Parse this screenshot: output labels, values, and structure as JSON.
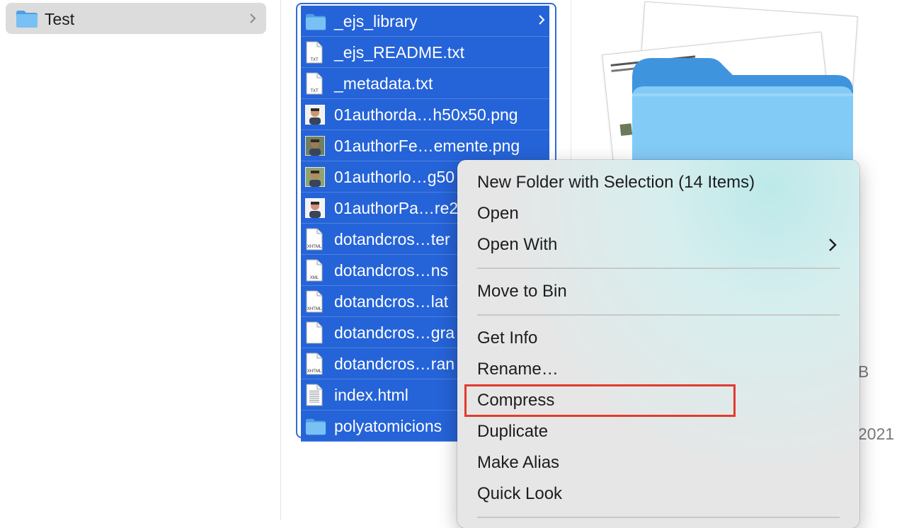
{
  "sidebar_column": {
    "folder": {
      "label": "Test",
      "icon": "folder-icon"
    }
  },
  "file_list": {
    "items": [
      {
        "name": "_ejs_library",
        "type": "folder",
        "icon": "folder-icon"
      },
      {
        "name": "_ejs_README.txt",
        "type": "txt",
        "icon": "txt-file-icon",
        "badge": "TXT"
      },
      {
        "name": "_metadata.txt",
        "type": "txt",
        "icon": "txt-file-icon",
        "badge": "TXT"
      },
      {
        "name": "01authorda…h50x50.png",
        "type": "image",
        "icon": "image-thumbnail-icon"
      },
      {
        "name": "01authorFe…emente.png",
        "type": "image",
        "icon": "image-thumbnail-icon"
      },
      {
        "name": "01authorlo…g50",
        "type": "image",
        "icon": "image-thumbnail-icon"
      },
      {
        "name": "01authorPa…re2",
        "type": "image",
        "icon": "image-thumbnail-icon"
      },
      {
        "name": "dotandcros…ter",
        "type": "xhtml",
        "icon": "xhtml-file-icon",
        "badge": "XHTML"
      },
      {
        "name": "dotandcros…ns",
        "type": "xml",
        "icon": "xml-file-icon",
        "badge": "XML"
      },
      {
        "name": "dotandcros…lat",
        "type": "xhtml",
        "icon": "xhtml-file-icon",
        "badge": "XHTML"
      },
      {
        "name": "dotandcros…gra",
        "type": "blank",
        "icon": "blank-file-icon"
      },
      {
        "name": "dotandcros…ran",
        "type": "xhtml",
        "icon": "xhtml-file-icon",
        "badge": "XHTML"
      },
      {
        "name": "index.html",
        "type": "html",
        "icon": "html-file-icon"
      },
      {
        "name": "polyatomicions",
        "type": "folder",
        "icon": "folder-icon"
      }
    ]
  },
  "preview": {
    "partial_text_size": "B",
    "partial_text_date": "2021"
  },
  "context_menu": {
    "items": [
      {
        "label": "New Folder with Selection (14 Items)"
      },
      {
        "label": "Open"
      },
      {
        "label": "Open With",
        "submenu": true
      },
      {
        "label": "Move to Bin"
      },
      {
        "label": "Get Info"
      },
      {
        "label": "Rename…"
      },
      {
        "label": "Compress",
        "highlighted": true
      },
      {
        "label": "Duplicate"
      },
      {
        "label": "Make Alias"
      },
      {
        "label": "Quick Look"
      }
    ]
  },
  "colors": {
    "selection": "#2563d8",
    "folder": "#5fb0ee",
    "highlight_box": "#e23b2e"
  }
}
